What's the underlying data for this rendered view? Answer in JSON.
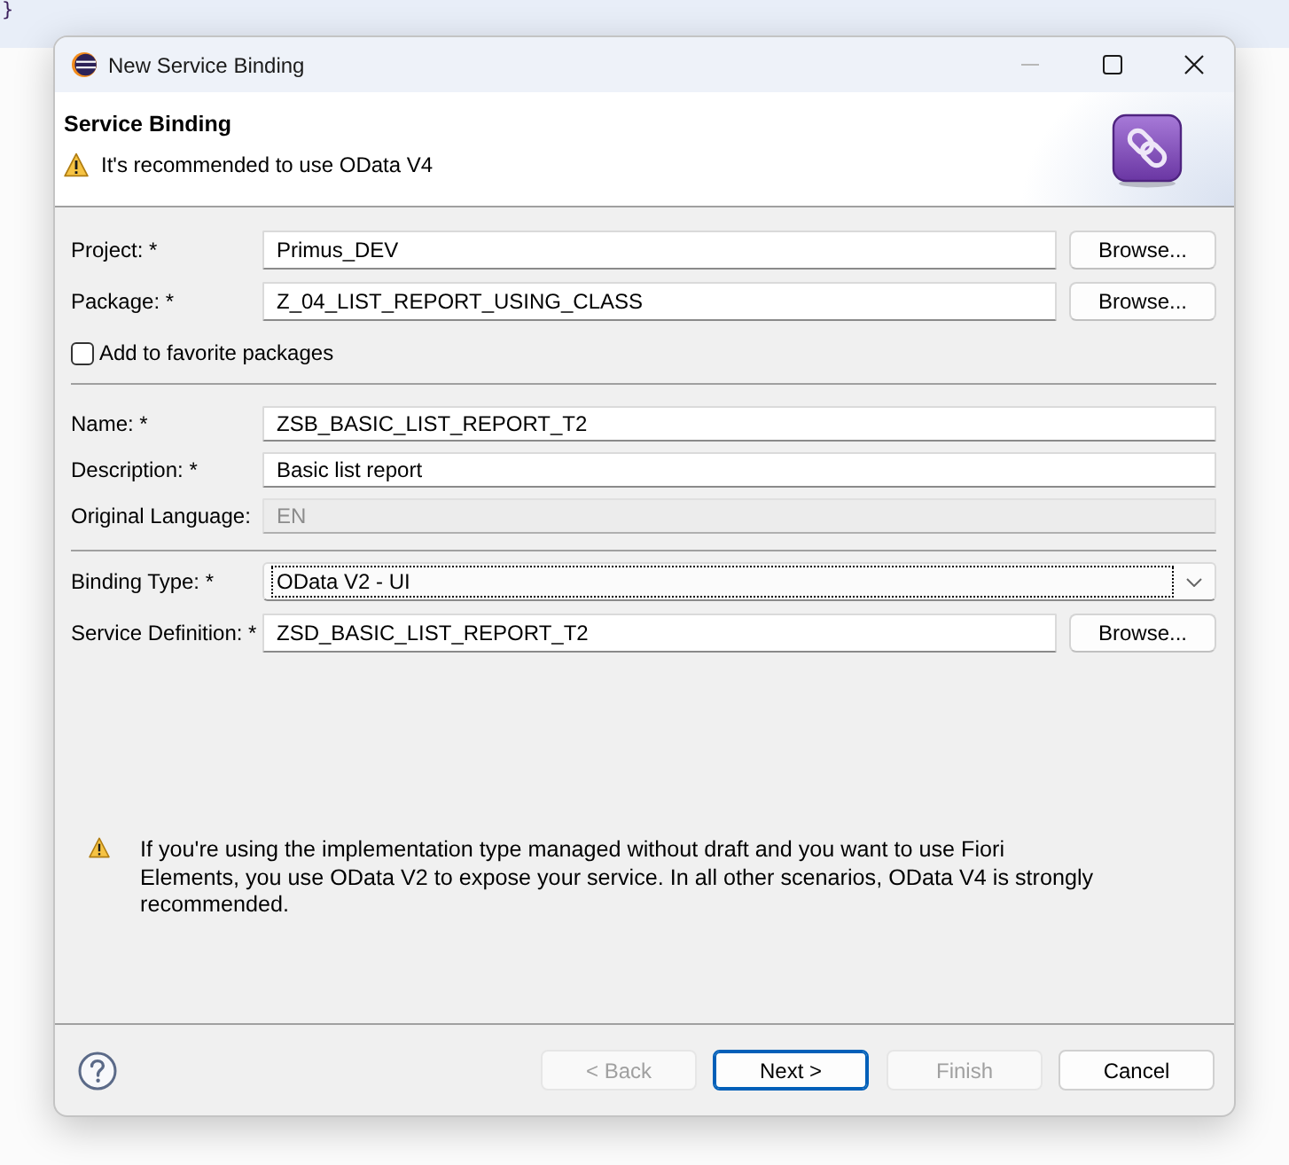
{
  "background": {
    "text": "}"
  },
  "window": {
    "title": "New Service Binding",
    "controls": [
      {
        "kind": "minimize",
        "disabled": true
      },
      {
        "kind": "maximize",
        "disabled": false
      },
      {
        "kind": "close",
        "disabled": false
      }
    ]
  },
  "header": {
    "title": "Service Binding",
    "message": "It's recommended to use OData V4"
  },
  "sections": [
    {
      "fields": [
        {
          "label": "Project: *",
          "kind": "text",
          "value": "Primus_DEV",
          "button": "Browse...",
          "disabled": false,
          "focused": false
        },
        {
          "label": "Package: *",
          "kind": "text",
          "value": "Z_04_LIST_REPORT_USING_CLASS",
          "button": "Browse...",
          "disabled": false,
          "focused": false
        }
      ],
      "checkbox": {
        "label": "Add to favorite packages",
        "checked": false
      }
    },
    {
      "fields": [
        {
          "label": "Name: *",
          "kind": "text",
          "value": "ZSB_BASIC_LIST_REPORT_T2",
          "disabled": false,
          "focused": false
        },
        {
          "label": "Description: *",
          "kind": "text",
          "value": "Basic list report",
          "disabled": false,
          "focused": false
        },
        {
          "label": "Original Language:",
          "kind": "text",
          "value": "EN",
          "disabled": true,
          "focused": false
        }
      ]
    },
    {
      "fields": [
        {
          "label": "Binding Type: *",
          "kind": "dropdown",
          "value": "OData V2 - UI",
          "disabled": false,
          "focused": true
        },
        {
          "label": "Service Definition: *",
          "kind": "text",
          "value": "ZSD_BASIC_LIST_REPORT_T2",
          "button": "Browse...",
          "disabled": false,
          "focused": false
        }
      ]
    }
  ],
  "info": {
    "message": "If you're using the implementation type managed without draft and you want to use Fiori Elements, you use OData V2 to expose your service. In all other scenarios, OData V4 is strongly recommended."
  },
  "footer": {
    "buttons": [
      {
        "label": "< Back",
        "disabled": true,
        "default": false
      },
      {
        "label": "Next >",
        "disabled": false,
        "default": true
      },
      {
        "label": "Finish",
        "disabled": true,
        "default": false
      },
      {
        "label": "Cancel",
        "disabled": false,
        "default": false
      }
    ]
  }
}
